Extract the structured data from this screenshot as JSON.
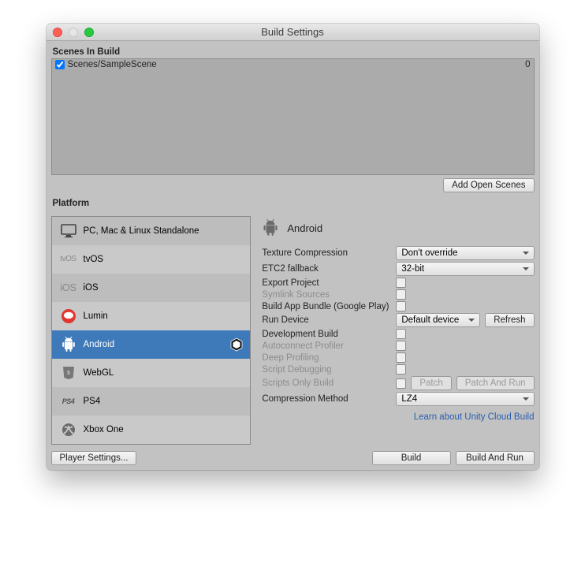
{
  "window": {
    "title": "Build Settings"
  },
  "scenes": {
    "heading": "Scenes In Build",
    "items": [
      {
        "checked": true,
        "path": "Scenes/SampleScene",
        "index": "0"
      }
    ],
    "add_button": "Add Open Scenes"
  },
  "platform": {
    "heading": "Platform",
    "items": [
      {
        "id": "standalone",
        "label": "PC, Mac & Linux Standalone",
        "selected": false,
        "icon": "monitor-icon"
      },
      {
        "id": "tvos",
        "label": "tvOS",
        "selected": false,
        "icon": "tvos-icon"
      },
      {
        "id": "ios",
        "label": "iOS",
        "selected": false,
        "icon": "ios-icon"
      },
      {
        "id": "lumin",
        "label": "Lumin",
        "selected": false,
        "icon": "lumin-icon"
      },
      {
        "id": "android",
        "label": "Android",
        "selected": true,
        "icon": "android-icon",
        "trailing": "unity-icon"
      },
      {
        "id": "webgl",
        "label": "WebGL",
        "selected": false,
        "icon": "html5-icon"
      },
      {
        "id": "ps4",
        "label": "PS4",
        "selected": false,
        "icon": "ps4-icon"
      },
      {
        "id": "xboxone",
        "label": "Xbox One",
        "selected": false,
        "icon": "xbox-icon"
      }
    ]
  },
  "detail": {
    "icon": "android-icon",
    "name": "Android",
    "settings": {
      "texture_compression": {
        "label": "Texture Compression",
        "value": "Don't override"
      },
      "etc2_fallback": {
        "label": "ETC2 fallback",
        "value": "32-bit"
      },
      "export_project": {
        "label": "Export Project",
        "value": false
      },
      "symlink_sources": {
        "label": "Symlink Sources",
        "disabled": true,
        "value": false
      },
      "build_app_bundle": {
        "label": "Build App Bundle (Google Play)",
        "value": false
      },
      "run_device": {
        "label": "Run Device",
        "value": "Default device",
        "refresh": "Refresh"
      },
      "development_build": {
        "label": "Development Build",
        "value": false
      },
      "autoconnect_profiler": {
        "label": "Autoconnect Profiler",
        "disabled": true,
        "value": false
      },
      "deep_profiling": {
        "label": "Deep Profiling",
        "disabled": true,
        "value": false
      },
      "script_debugging": {
        "label": "Script Debugging",
        "disabled": true,
        "value": false
      },
      "scripts_only": {
        "label": "Scripts Only Build",
        "disabled": true,
        "value": false,
        "patch": "Patch",
        "patch_and_run": "Patch And Run"
      },
      "compression": {
        "label": "Compression Method",
        "value": "LZ4"
      }
    },
    "cloud_link": "Learn about Unity Cloud Build"
  },
  "footer": {
    "player_settings": "Player Settings...",
    "build": "Build",
    "build_and_run": "Build And Run"
  }
}
